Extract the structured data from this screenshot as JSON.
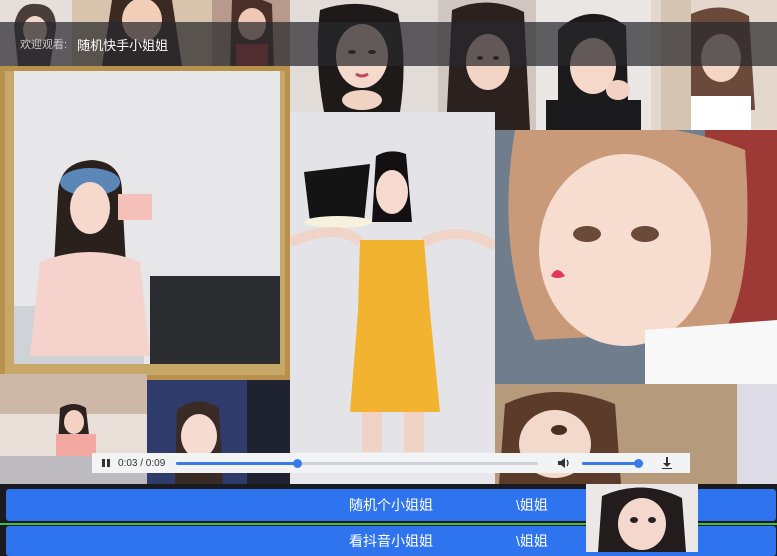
{
  "header": {
    "welcome": "欢迎观看:",
    "title": "随机快手小姐姐"
  },
  "player": {
    "current_time": "0:03",
    "duration": "0:09",
    "time_display": "0:03 / 0:09",
    "progress": 0.333,
    "volume": 0.9,
    "state": "playing"
  },
  "buttons": {
    "random_label": "随机个小姐姐",
    "random_ghost": "\\姐姐",
    "douyin_label": "看抖音小姐姐",
    "douyin_ghost": "\\姐姐"
  },
  "colors": {
    "button_blue": "#2f74ef",
    "player_accent": "#3a7ae8",
    "header_bg": "#28282c"
  },
  "icons": {
    "play_state": "pause-icon",
    "volume": "volume-icon",
    "download": "download-icon"
  }
}
